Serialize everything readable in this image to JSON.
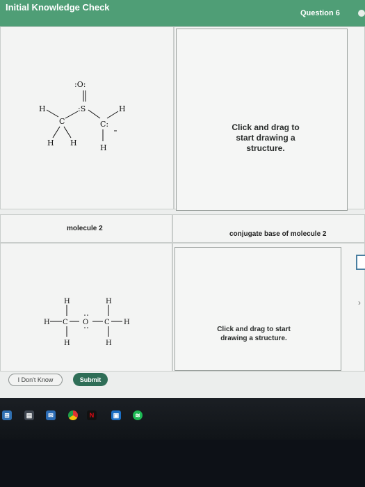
{
  "header": {
    "title": "Initial Knowledge Check",
    "question": "Question 6"
  },
  "problem1": {
    "hint": "Click and drag to start drawing a structure."
  },
  "problem2": {
    "molecule_caption": "molecule 2",
    "answer_caption": "conjugate base of molecule 2",
    "hint": "Click and drag to start drawing a structure."
  },
  "molecule1": {
    "O": ":O:",
    "S": ":S",
    "C1": "C",
    "C2": "C:",
    "H_left": "H",
    "H_top_right": "H",
    "H_b1": "H",
    "H_b2": "H",
    "H_b3": "H"
  },
  "molecule2": {
    "H": "H",
    "C": "C",
    "O": "O"
  },
  "buttons": {
    "dont_know": "I Don't Know",
    "submit": "Submit"
  },
  "taskbar": {
    "icons": [
      "windows-icon",
      "store-icon",
      "mail-icon",
      "chrome-icon",
      "netflix-icon",
      "photos-icon",
      "spotify-icon"
    ],
    "netflix_letter": "N"
  },
  "colors": {
    "header": "#4f9e76",
    "submit": "#2f6e57",
    "taskbar": "#101418"
  }
}
